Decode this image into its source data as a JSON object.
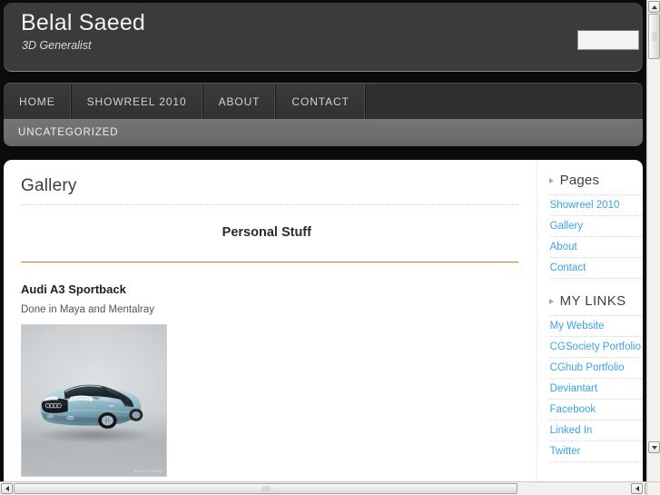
{
  "site": {
    "title": "Belal Saeed",
    "tagline": "3D Generalist"
  },
  "search": {
    "value": "",
    "placeholder": ""
  },
  "nav": {
    "items": [
      {
        "label": "HOME"
      },
      {
        "label": "SHOWREEL 2010"
      },
      {
        "label": "ABOUT"
      },
      {
        "label": "CONTACT"
      }
    ]
  },
  "subnav": {
    "items": [
      {
        "label": "UNCATEGORIZED"
      }
    ]
  },
  "main": {
    "page_title": "Gallery",
    "section_heading": "Personal Stuff",
    "post": {
      "title": "Audi A3 Sportback",
      "description": "Done in Maya and Mentalray",
      "image_alt": "Audi A3 Sportback 3D render",
      "watermark": "BELAL SAEED"
    }
  },
  "sidebar": {
    "widgets": [
      {
        "title": "Pages",
        "links": [
          {
            "label": "Showreel 2010"
          },
          {
            "label": "Gallery"
          },
          {
            "label": "About"
          },
          {
            "label": "Contact"
          }
        ]
      },
      {
        "title": "MY LINKS",
        "links": [
          {
            "label": "My Website"
          },
          {
            "label": "CGSociety Portfolio"
          },
          {
            "label": "CGhub Portfolio"
          },
          {
            "label": "Deviantart"
          },
          {
            "label": "Facebook"
          },
          {
            "label": "Linked In"
          },
          {
            "label": "Twitter"
          }
        ]
      }
    ]
  },
  "colors": {
    "accent_orange": "#e8701a",
    "link_blue": "#3ba3e8",
    "header_bg": "#3b3b3b",
    "subnav_bg": "#6e6e6e",
    "page_bg": "#0b0b0b"
  }
}
